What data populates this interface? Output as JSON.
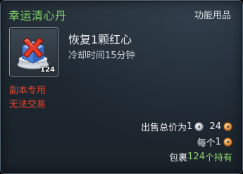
{
  "item": {
    "name": "幸运清心丹",
    "category": "功能用品",
    "icon": "cleansing-pill-red-x-icon",
    "stack_count": "124",
    "effect": "恢复1颗红心",
    "cooldown": "冷却时间15分钟",
    "restrictions": [
      "副本专用",
      "无法交易"
    ]
  },
  "price": {
    "total_label": "出售总价为",
    "total_silver": "1",
    "total_copper": "24",
    "each_label": "每个",
    "each_copper": "1"
  },
  "inventory": {
    "prefix": "包裹",
    "count": "124",
    "suffix": "个持有"
  },
  "colors": {
    "title": "#7fd36a",
    "restriction": "#e0452f",
    "highlight": "#8fd36e"
  }
}
